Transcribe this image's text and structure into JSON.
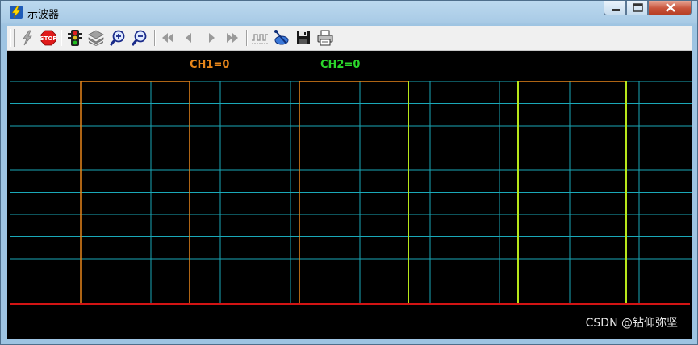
{
  "window": {
    "title": "示波器"
  },
  "toolbar": {
    "buttons": [
      {
        "name": "lightning-button",
        "icon": "lightning-icon"
      },
      {
        "name": "stop-button",
        "icon": "stop-sign-icon",
        "label": "STOP"
      },
      {
        "name": "traffic-light-button",
        "icon": "traffic-light-icon"
      },
      {
        "name": "layers-button",
        "icon": "layers-icon"
      },
      {
        "name": "zoom-in-button",
        "icon": "zoom-in-icon"
      },
      {
        "name": "zoom-out-button",
        "icon": "zoom-out-icon"
      },
      {
        "name": "fast-backward-button",
        "icon": "fast-backward-icon"
      },
      {
        "name": "step-backward-button",
        "icon": "step-backward-icon"
      },
      {
        "name": "step-forward-button",
        "icon": "step-forward-icon"
      },
      {
        "name": "fast-forward-button",
        "icon": "fast-forward-icon"
      },
      {
        "name": "waveform-button",
        "icon": "waveform-icon"
      },
      {
        "name": "probe-button",
        "icon": "probe-icon"
      },
      {
        "name": "save-button",
        "icon": "floppy-disk-icon"
      },
      {
        "name": "print-button",
        "icon": "printer-icon"
      }
    ]
  },
  "channels": {
    "ch1": {
      "label": "CH1=0",
      "color": "#e8861a"
    },
    "ch2": {
      "label": "CH2=0",
      "color": "#2bd62b"
    }
  },
  "colors": {
    "grid": "#1aa8b8",
    "baseline": "#d21414",
    "ch1_trace": "#e8861a",
    "ch2_trace": "#b6e61a",
    "background": "#000000"
  },
  "watermark": "CSDN @钻仰弥坚"
}
